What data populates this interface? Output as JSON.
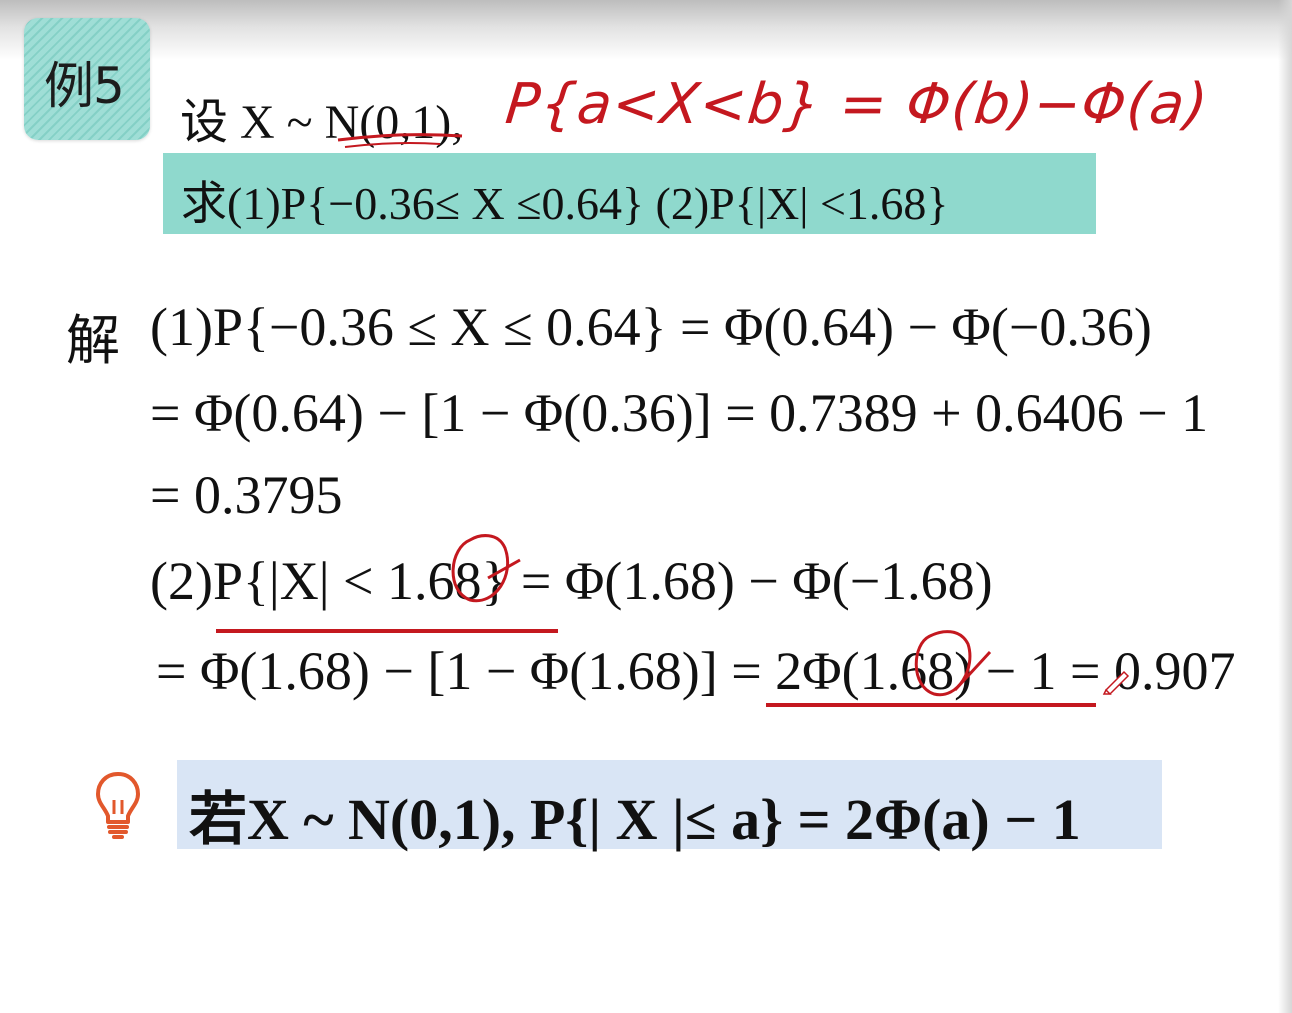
{
  "badge": {
    "label": "例5"
  },
  "premise": {
    "text": "设 X ~ N(0,1),"
  },
  "annotation": {
    "handwriting": "P{a<X<b} = Φ(b)−Φ(a)"
  },
  "question": {
    "text": "求(1)P{−0.36≤ X ≤0.64}  (2)P{|X| <1.68}"
  },
  "solution": {
    "label": "解",
    "lines": [
      "(1)P{−0.36 ≤ X ≤ 0.64} = Φ(0.64) − Φ(−0.36)",
      "= Φ(0.64) − [1 − Φ(0.36)] = 0.7389 + 0.6406 − 1",
      "= 0.3795",
      "(2)P{|X| < 1.68} = Φ(1.68) − Φ(−1.68)",
      "= Φ(1.68) − [1 − Φ(1.68)] = 2Φ(1.68) − 1 = 0.907"
    ]
  },
  "tip": {
    "icon": "lightbulb-icon",
    "text": "若X ~ N(0,1), P{| X |≤ a} = 2Φ(a) − 1"
  },
  "colors": {
    "teal": "#8fd9cd",
    "tip_bg": "#d9e5f5",
    "ink_red": "#c4181f",
    "bulb_orange": "#e2582c"
  }
}
